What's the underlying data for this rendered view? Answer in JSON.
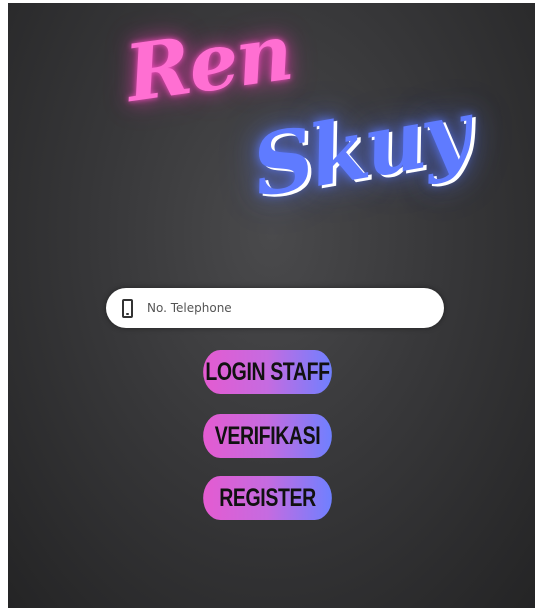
{
  "logo": {
    "word1": "Ren",
    "word2": "Skuy",
    "color1": "#ff6fd2",
    "color2": "#5f7bff"
  },
  "phone_field": {
    "icon": "phone-icon",
    "placeholder": "No. Telephone",
    "value": ""
  },
  "buttons": {
    "login_staff": "LOGIN STAFF",
    "verifikasi": "VERIFIKASI",
    "register": "REGISTER"
  },
  "colors": {
    "background": "#38383a",
    "button_gradient_start": "#e45bd1",
    "button_gradient_end": "#6f80ff",
    "button_text": "#111111"
  }
}
